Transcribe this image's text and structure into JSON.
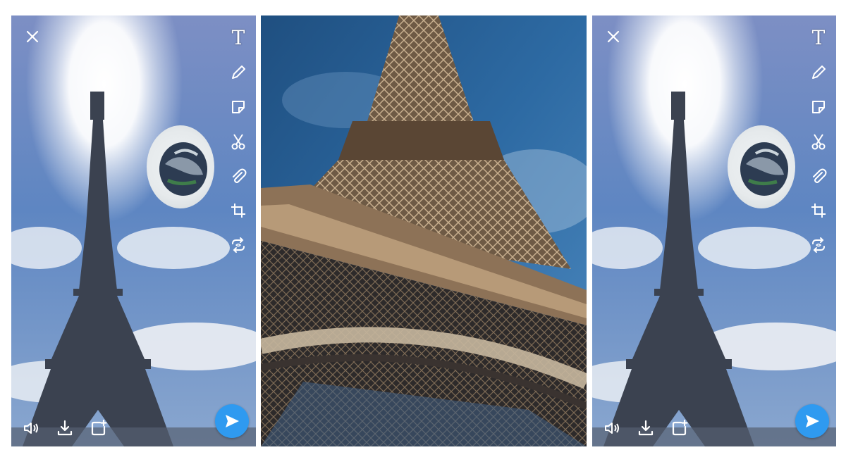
{
  "panels": [
    {
      "id": "left",
      "variant": "edit-view"
    },
    {
      "id": "middle",
      "variant": "photo-only"
    },
    {
      "id": "right",
      "variant": "edit-view"
    }
  ],
  "toolbar": {
    "text_tool": "T",
    "items": [
      "text-tool",
      "pencil-icon",
      "sticker-icon",
      "scissors-icon",
      "paperclip-icon",
      "crop-icon",
      "loop-icon"
    ]
  },
  "bottom_bar": [
    "speaker-icon",
    "download-icon",
    "add-story-icon"
  ],
  "colors": {
    "send_button": "#2f9af0",
    "sky_top": "#6f8fbf",
    "tower": "#3a3f4a"
  }
}
